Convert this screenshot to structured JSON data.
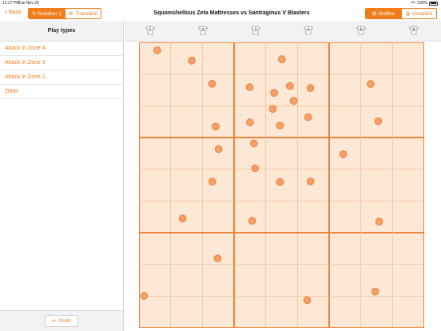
{
  "status": {
    "time": "12:27 PM",
    "date": "Tue Nov 26",
    "battery": "100%"
  },
  "nav": {
    "back_label": "Back",
    "title": "Squomshellous Zeta Mattresses vs Santraginus V Blasters",
    "left_segment": [
      "Rotation 1",
      "Transition"
    ],
    "right_segment": [
      "Ordline",
      "Visualize"
    ]
  },
  "sidebar": {
    "header": "Play types",
    "items": [
      "Attack in Zone 4",
      "Attack in Zone 3",
      "Attack in Zone 2",
      "Other"
    ],
    "undo_label": "Undo"
  },
  "court": {
    "jerseys": [
      "1",
      "2",
      "3",
      "4",
      "5",
      "6"
    ],
    "colors": {
      "accent": "#f07d1a",
      "cell_fill": "#fde8d6",
      "thin_line": "#f5b98a",
      "thick_line": "#e8782a",
      "dot_fill": "#f5a06a",
      "dot_stroke": "#e8782a"
    },
    "dots": [
      [
        0.064,
        0.028
      ],
      [
        0.185,
        0.064
      ],
      [
        0.501,
        0.059
      ],
      [
        0.256,
        0.145
      ],
      [
        0.388,
        0.157
      ],
      [
        0.474,
        0.177
      ],
      [
        0.529,
        0.153
      ],
      [
        0.601,
        0.16
      ],
      [
        0.812,
        0.146
      ],
      [
        0.542,
        0.205
      ],
      [
        0.469,
        0.233
      ],
      [
        0.593,
        0.262
      ],
      [
        0.389,
        0.28
      ],
      [
        0.494,
        0.291
      ],
      [
        0.269,
        0.295
      ],
      [
        0.839,
        0.276
      ],
      [
        0.403,
        0.354
      ],
      [
        0.279,
        0.374
      ],
      [
        0.716,
        0.392
      ],
      [
        0.407,
        0.441
      ],
      [
        0.257,
        0.488
      ],
      [
        0.494,
        0.489
      ],
      [
        0.601,
        0.487
      ],
      [
        0.153,
        0.617
      ],
      [
        0.397,
        0.625
      ],
      [
        0.842,
        0.628
      ],
      [
        0.276,
        0.757
      ],
      [
        0.018,
        0.888
      ],
      [
        0.828,
        0.873
      ],
      [
        0.59,
        0.903
      ]
    ]
  }
}
